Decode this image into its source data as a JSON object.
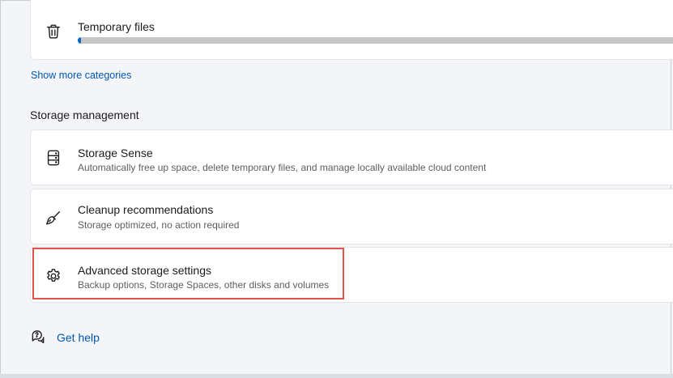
{
  "categories": {
    "temporary_files": {
      "label": "Temporary files",
      "icon": "trash-icon",
      "usage_fraction": 0.005
    },
    "show_more_label": "Show more categories"
  },
  "storage_management": {
    "header": "Storage management",
    "items": [
      {
        "title": "Storage Sense",
        "subtitle": "Automatically free up space, delete temporary files, and manage locally available cloud content",
        "icon": "storage-sense-icon"
      },
      {
        "title": "Cleanup recommendations",
        "subtitle": "Storage optimized, no action required",
        "icon": "broom-icon"
      },
      {
        "title": "Advanced storage settings",
        "subtitle": "Backup options, Storage Spaces, other disks and volumes",
        "icon": "gear-icon"
      }
    ]
  },
  "help": {
    "label": "Get help",
    "icon": "help-icon"
  },
  "colors": {
    "accent": "#0067c0",
    "link": "#0058b0",
    "highlight_border": "#e5524b",
    "track": "#c6c6c6"
  }
}
